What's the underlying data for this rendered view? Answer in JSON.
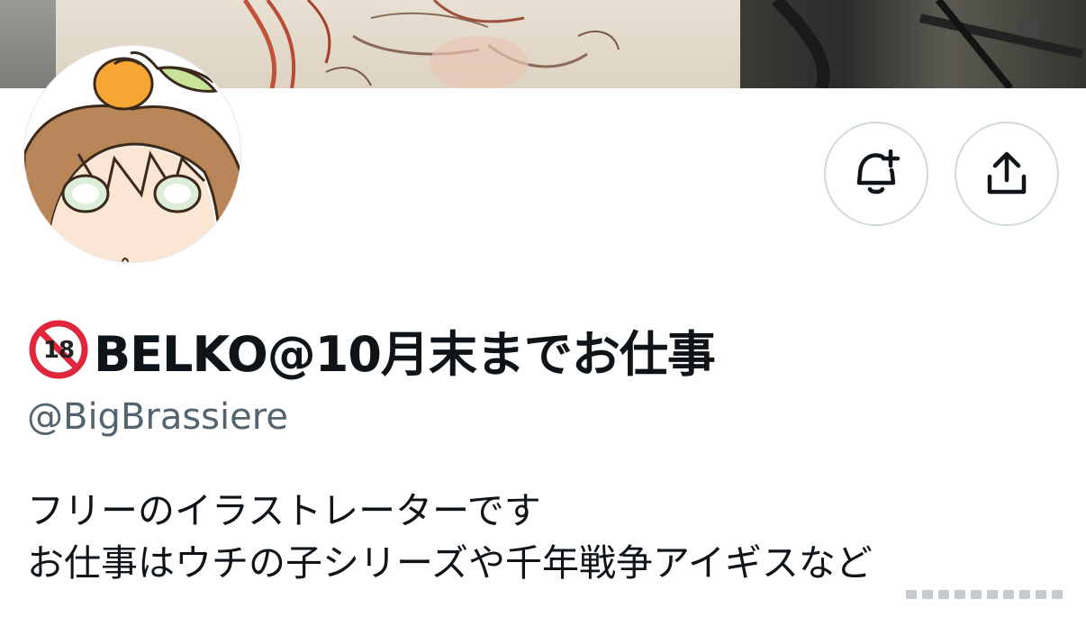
{
  "profile": {
    "display_name": "BELKO@10月末までお仕事",
    "handle": "@BigBrassiere",
    "bio_lines": [
      "フリーのイラストレーターです",
      "お仕事はウチの子シリーズや千年戦争アイギスなど"
    ],
    "badge_icon": "no-under-18-icon"
  },
  "actions": {
    "notify_icon": "bell-plus-icon",
    "share_icon": "share-upload-icon"
  },
  "colors": {
    "text": "#0f1419",
    "secondary_text": "#536471",
    "button_border": "#cfd9de",
    "badge_red": "#e0263a"
  }
}
